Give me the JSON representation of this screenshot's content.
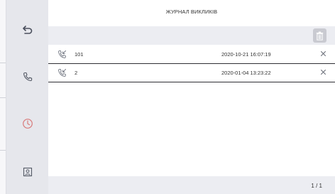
{
  "header": {
    "title": "ЖУРНАЛ ВИКЛИКІВ"
  },
  "sidebar": {
    "items": [
      {
        "icon": "back-arrow-icon",
        "state": "default"
      },
      {
        "icon": "phone-icon",
        "state": "default"
      },
      {
        "icon": "clock-icon",
        "state": "active"
      },
      {
        "icon": "contacts-icon",
        "state": "default"
      }
    ]
  },
  "call_log": {
    "rows": [
      {
        "icon": "incoming-call-icon",
        "number": "101",
        "datetime": "2020-10-21 16:07:19"
      },
      {
        "icon": "incoming-call-icon",
        "number": "2",
        "datetime": "2020-01-04 13:23:22"
      }
    ]
  },
  "footer": {
    "page": "1 / 1"
  },
  "colors": {
    "sidebar_bg": "#e6e7ec",
    "toolbar_bg": "#ecedf2",
    "active_icon": "#d97b7b",
    "icon": "#555a66",
    "trash_bg": "#c9cad1"
  }
}
